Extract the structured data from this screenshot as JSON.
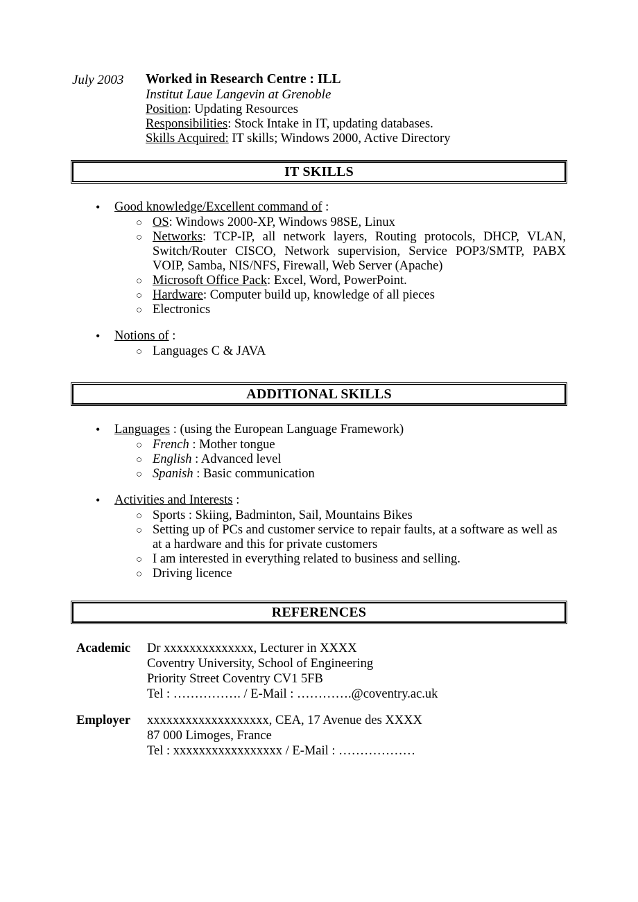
{
  "document": {
    "type": "curriculum-vitae-page",
    "page_background": "#ffffff",
    "text_color": "#000000"
  },
  "experience": {
    "date": "July 2003",
    "title": "Worked in Research Centre : ILL",
    "subtitle": "Institut Laue Langevin at Grenoble",
    "lines": [
      {
        "label": "Position",
        "label_underlined": "Position",
        "colon_in_underline": false,
        "text": ": Updating Resources"
      },
      {
        "label": "Responsibilities",
        "label_underlined": "Responsibilities",
        "colon_in_underline": false,
        "text": ": Stock Intake in IT, updating databases."
      },
      {
        "label": "Skills Acquired:",
        "label_underlined": "Skills Acquired:",
        "colon_in_underline": true,
        "text": " IT skills; Windows 2000, Active Directory"
      }
    ],
    "position_label": "Position",
    "position_value": ": Updating Resources",
    "responsibilities_label": "Responsibilities",
    "responsibilities_value": ": Stock Intake in IT, updating databases.",
    "skills_acquired_label": "Skills Acquired:",
    "skills_acquired_value": " IT skills; Windows 2000, Active Directory"
  },
  "sections": {
    "it_skills": {
      "banner": "IT SKILLS",
      "groups": [
        {
          "heading_underlined": "Good knowledge/Excellent command of",
          "heading_tail": " :",
          "items": [
            {
              "label": "OS",
              "label_underlined": true,
              "text": ": Windows 2000-XP, Windows 98SE, Linux",
              "justified": false
            },
            {
              "label": "Networks",
              "label_underlined": true,
              "text": ": TCP-IP, all network layers, Routing protocols, DHCP, VLAN, Switch/Router CISCO, Network supervision, Service POP3/SMTP, PABX VOIP, Samba, NIS/NFS, Firewall, Web Server (Apache)",
              "justified": true
            },
            {
              "label": "Microsoft Office Pack",
              "label_underlined": true,
              "text": ": Excel, Word, PowerPoint.",
              "justified": false
            },
            {
              "label": "Hardware",
              "label_underlined": true,
              "text": ": Computer build up, knowledge of all pieces",
              "justified": false
            },
            {
              "label": "",
              "label_underlined": false,
              "text": "Electronics",
              "justified": false
            }
          ]
        },
        {
          "heading_underlined": "Notions of",
          "heading_tail": " :",
          "items": [
            {
              "label": "",
              "label_underlined": false,
              "text": "Languages C & JAVA",
              "justified": false
            }
          ]
        }
      ]
    },
    "additional_skills": {
      "banner": "ADDITIONAL SKILLS",
      "groups": [
        {
          "heading_underlined": "Languages",
          "heading_tail": " : (using the European Language Framework)",
          "items": [
            {
              "label": "French",
              "label_italic": true,
              "text": " : Mother tongue"
            },
            {
              "label": "English",
              "label_italic": true,
              "text": " : Advanced level"
            },
            {
              "label": "Spanish",
              "label_italic": true,
              "text": " : Basic communication"
            }
          ]
        },
        {
          "heading_underlined": "Activities and Interests",
          "heading_tail": " :",
          "items": [
            {
              "label": "",
              "label_italic": false,
              "text": "Sports : Skiing, Badminton, Sail, Mountains Bikes"
            },
            {
              "label": "",
              "label_italic": false,
              "text": "Setting up of PCs and customer service to repair faults, at a software as well as at a hardware and this for private customers"
            },
            {
              "label": "",
              "label_italic": false,
              "text": "I am interested in everything related to business and selling."
            },
            {
              "label": "",
              "label_italic": false,
              "text": "Driving licence"
            }
          ]
        }
      ]
    },
    "references": {
      "banner": "REFERENCES",
      "entries": [
        {
          "label": "Academic",
          "lines": [
            "Dr xxxxxxxxxxxxxx, Lecturer in XXXX",
            "Coventry University, School of Engineering",
            "Priority Street Coventry CV1 5FB",
            "Tel : ……………. / E-Mail : ………….@coventry.ac.uk"
          ]
        },
        {
          "label": "Employer",
          "lines": [
            "xxxxxxxxxxxxxxxxxxx, CEA, 17 Avenue des XXXX",
            "87 000 Limoges, France",
            "Tel : xxxxxxxxxxxxxxxxx / E-Mail : ………………"
          ]
        }
      ]
    }
  },
  "glyphs": {
    "bullet": "•",
    "circle": "○"
  }
}
